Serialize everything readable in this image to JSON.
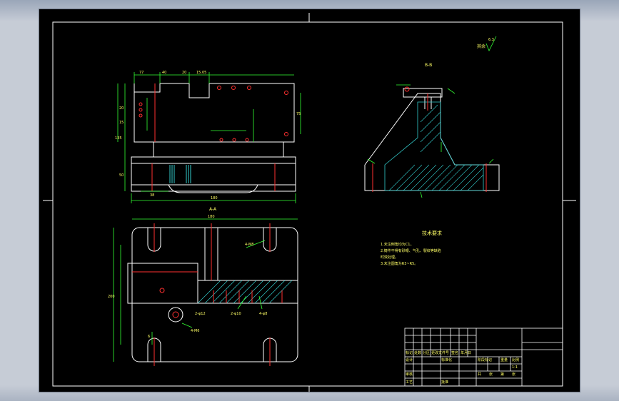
{
  "drawing": {
    "section_top_right_label": "B-B",
    "section_bottom_left_label": "A-A",
    "roughness_note": "其余",
    "roughness_value": "6.3",
    "tech_title": "技术要求",
    "tech_lines": [
      "1.未注倒角均为C1。",
      "2.铸件不得有砂眼、气孔、裂纹等缺陷",
      "   时效处理。",
      "3.未注圆角为R3~R5。"
    ],
    "title_block": {
      "row_labels": [
        "标记",
        "设计",
        "审核",
        "工艺"
      ],
      "mid_labels": [
        "处数",
        "分区",
        "更改文件号",
        "签名",
        "年月日"
      ],
      "stage_label": "阶段标记",
      "weight_label": "重量",
      "scale_label": "比例",
      "scale_value": "1:1",
      "sheet_labels": [
        "共",
        "张",
        "第",
        "张"
      ],
      "std_label": "标准化",
      "approve_label": "批准"
    },
    "dims": {
      "top_widths": [
        "77",
        "40",
        "20",
        "15.05"
      ],
      "overall_width": "180",
      "overall_height": "135",
      "bottom_width": "38",
      "plan_width": "180",
      "plan_height": "200",
      "left_dims": [
        "20",
        "15",
        "50",
        "75"
      ],
      "small_dim": "6"
    },
    "callouts": [
      "4-M8",
      "2-φ10",
      "4-φ8",
      "4-M6",
      "2-φ12"
    ]
  }
}
